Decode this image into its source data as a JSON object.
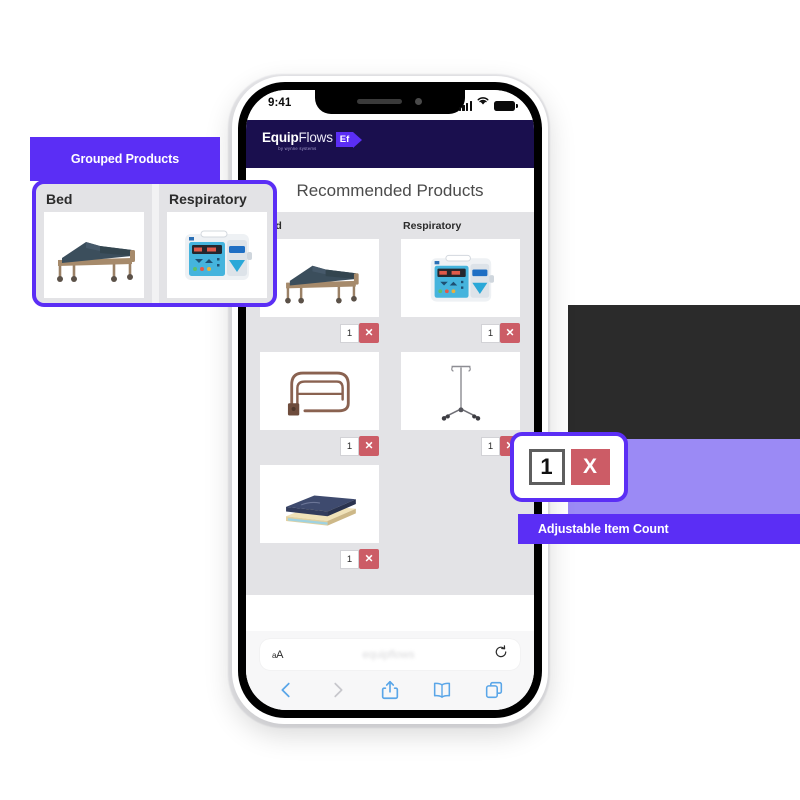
{
  "background": {
    "accent_purple": "#5B2EF5",
    "light_purple": "#9B8AF5",
    "dark_block": "#2B2B2B",
    "delete_red": "#CC5C66",
    "header_navy": "#1A0F4E",
    "board_gray": "#E3E3E6"
  },
  "phone": {
    "status_bar": {
      "time": "9:41",
      "signal_icon": "cellular-signal-icon",
      "wifi_icon": "wifi-icon",
      "battery_icon": "battery-icon"
    },
    "app_header": {
      "logo_bold": "Equip",
      "logo_thin": "Flows",
      "logo_subtitle": "by wynne systems",
      "logo_badge": "Ef",
      "arrow_icon": "triangle-right-icon"
    },
    "page_title": "Recommended Products",
    "categories": [
      {
        "name": "Bed",
        "products": [
          {
            "image": "hospital-bed-image",
            "qty": "1",
            "delete_label": "✕"
          },
          {
            "image": "bed-rail-image",
            "qty": "1",
            "delete_label": "✕"
          },
          {
            "image": "mattress-image",
            "qty": "1",
            "delete_label": "✕"
          }
        ]
      },
      {
        "name": "Respiratory",
        "products": [
          {
            "image": "infusion-pump-image",
            "qty": "1",
            "delete_label": "✕"
          },
          {
            "image": "iv-pole-image",
            "qty": "1",
            "delete_label": "✕"
          }
        ]
      }
    ],
    "safari": {
      "text_size_label": "aA",
      "url_ghost": "equipflows",
      "reload_icon": "reload-icon",
      "toolbar": [
        {
          "icon": "back-chevron-icon",
          "enabled": true
        },
        {
          "icon": "forward-chevron-icon",
          "enabled": false
        },
        {
          "icon": "share-icon",
          "enabled": true
        },
        {
          "icon": "bookmarks-book-icon",
          "enabled": true
        },
        {
          "icon": "tabs-icon",
          "enabled": true
        }
      ]
    }
  },
  "callouts": {
    "grouped": {
      "label": "Grouped Products",
      "zoom_categories": [
        {
          "name": "Bed",
          "image": "hospital-bed-image"
        },
        {
          "name": "Respiratory",
          "image": "infusion-pump-image"
        }
      ]
    },
    "item_count": {
      "label": "Adjustable Item Count",
      "qty": "1",
      "delete_label": "X"
    }
  }
}
